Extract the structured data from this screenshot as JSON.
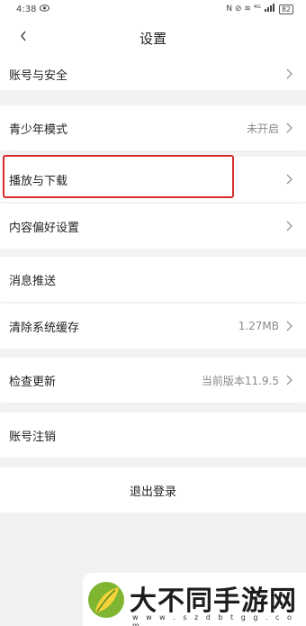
{
  "status_bar": {
    "time": "4:38",
    "right_text": "N ⊘ ≋ ⁴ᴳ",
    "battery": "82"
  },
  "header": {
    "title": "设置"
  },
  "settings": {
    "account_security": "账号与安全",
    "teen_mode": "青少年模式",
    "teen_mode_value": "未开启",
    "play_download": "播放与下载",
    "content_preferences": "内容偏好设置",
    "message_push": "消息推送",
    "clear_cache": "清除系统缓存",
    "cache_size": "1.27MB",
    "check_update": "检查更新",
    "current_version": "当前版本11.9.5",
    "account_cancel": "账号注销"
  },
  "logout_label": "退出登录",
  "watermark": {
    "title": "大不同手游网",
    "url": "w w w . s z d b t g g . c o m"
  }
}
